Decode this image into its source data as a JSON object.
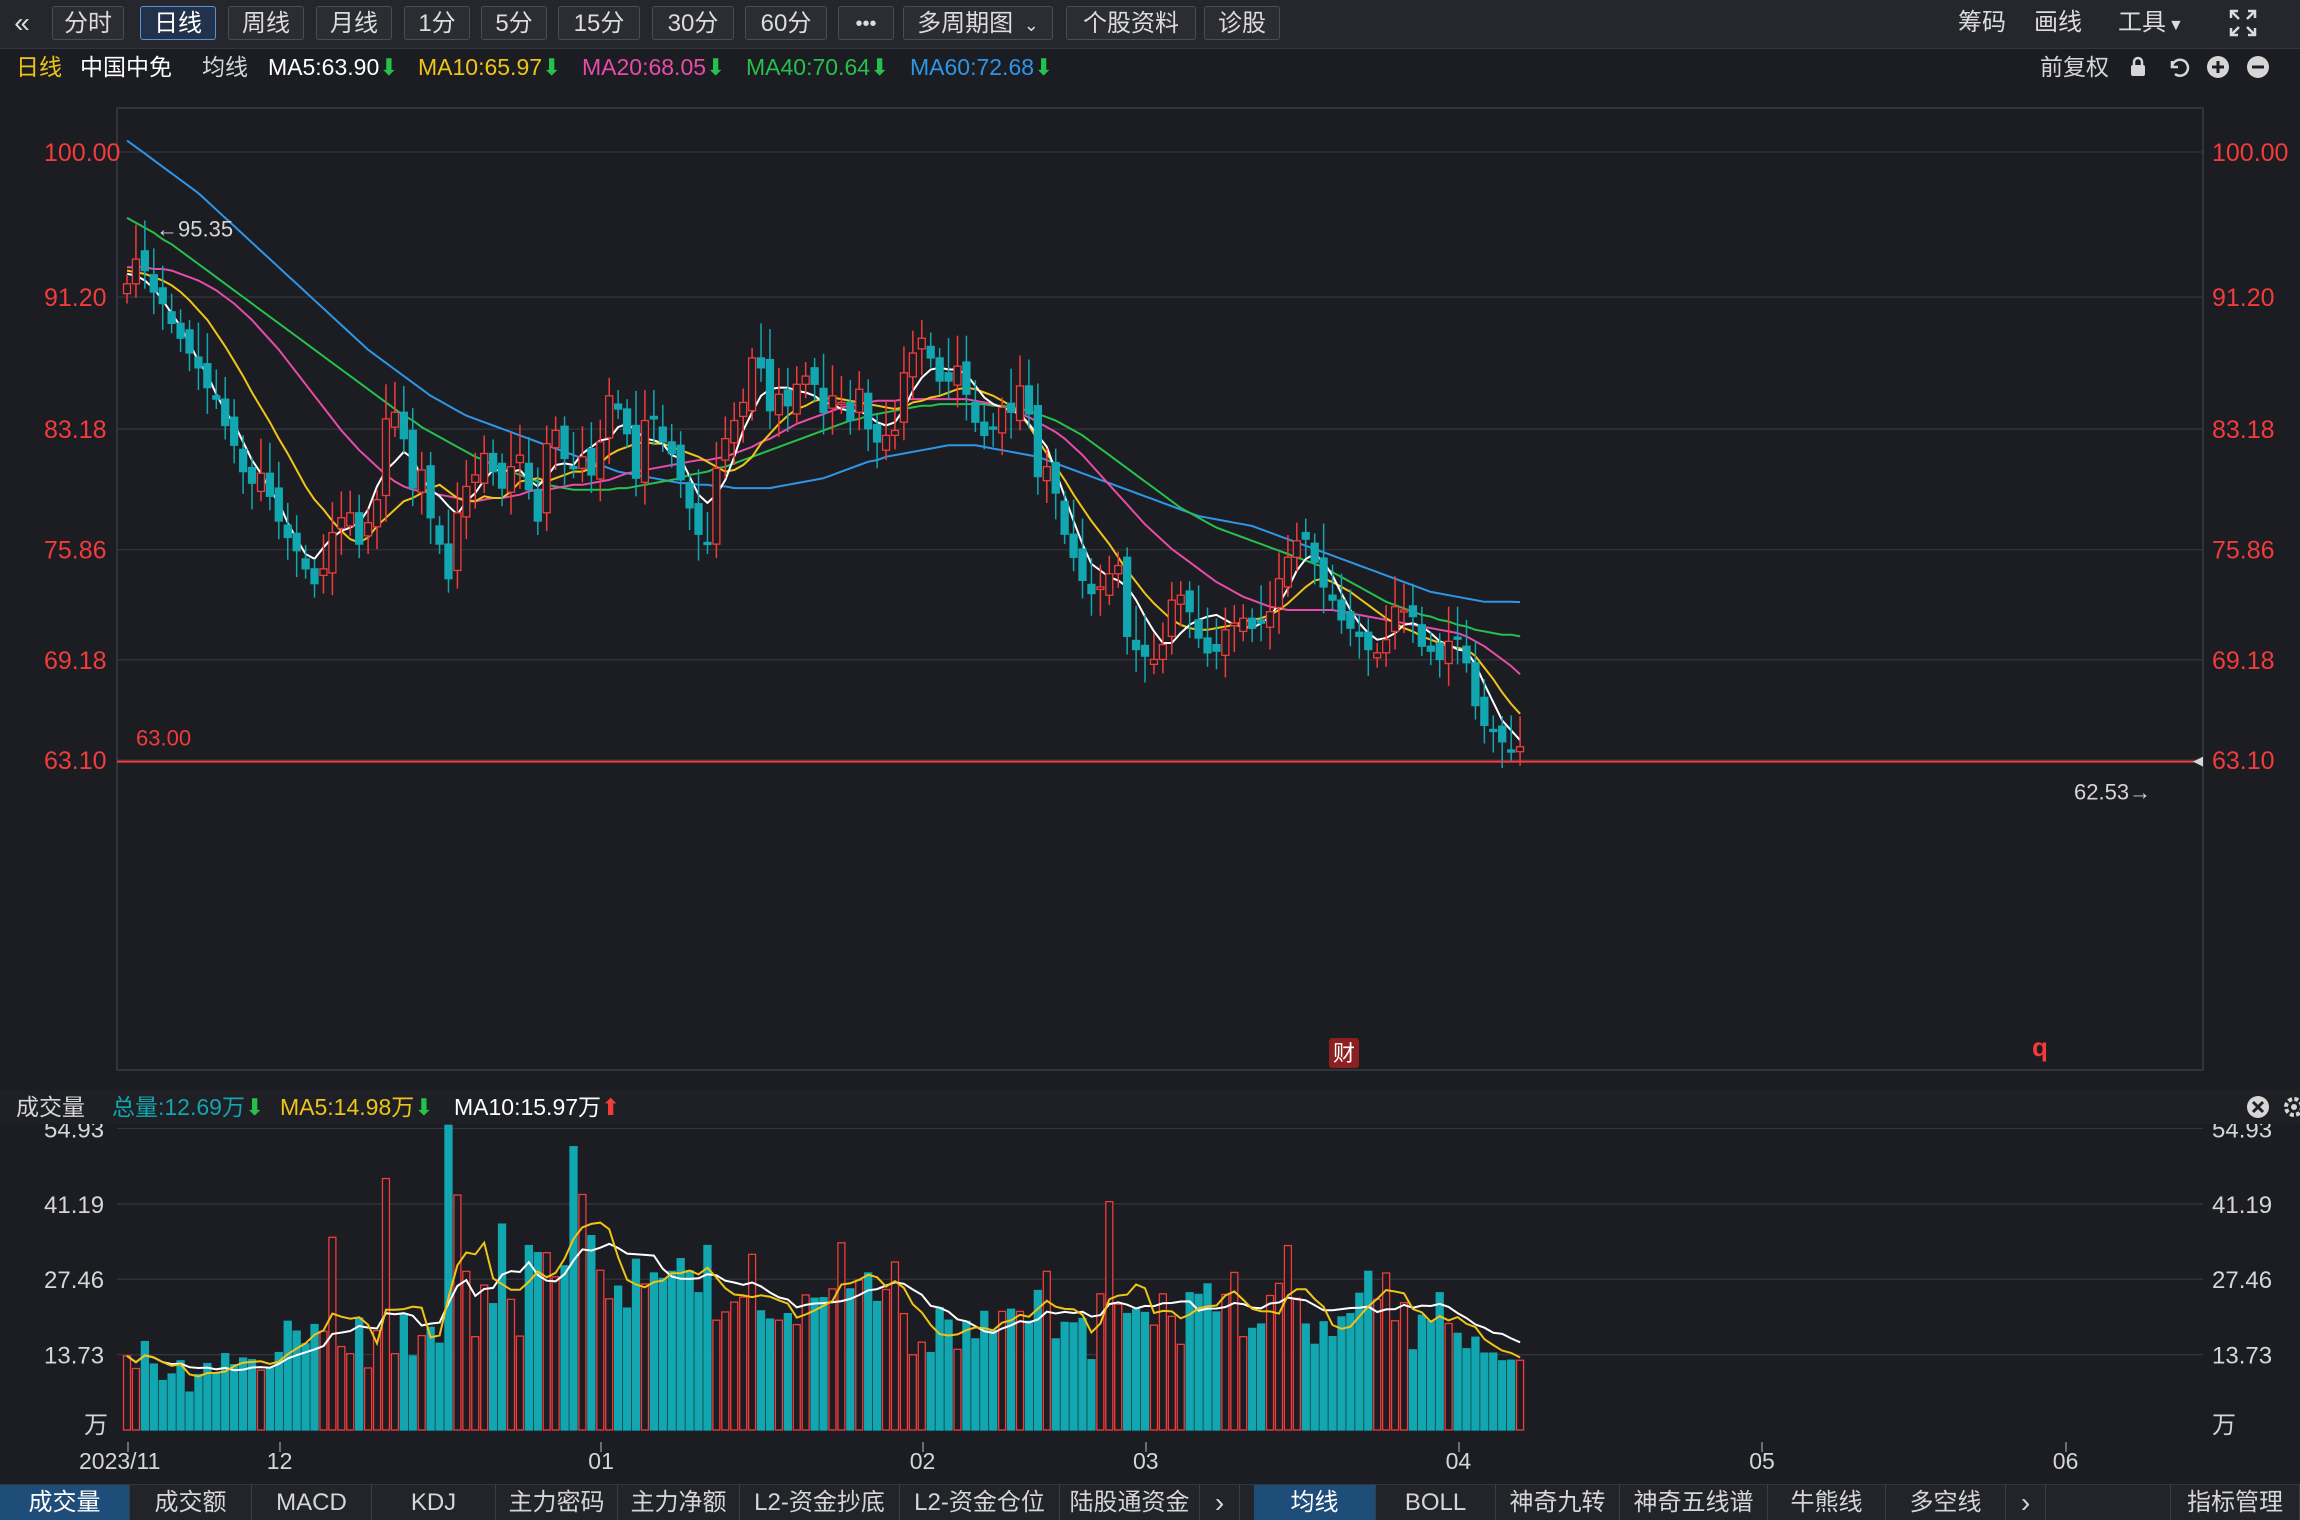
{
  "toolbar": {
    "back_icon": "double-chevron-left-icon",
    "periods": [
      "分时",
      "日线",
      "周线",
      "月线",
      "1分",
      "5分",
      "15分",
      "30分",
      "60分"
    ],
    "active_period": "日线",
    "more_label": "•••",
    "multi_period": "多周期图",
    "stock_info": "个股资料",
    "diagnose": "诊股",
    "chips": "筹码",
    "draw": "画线",
    "tools": "工具",
    "fullscreen_icon": "fullscreen-icon"
  },
  "header": {
    "period": "日线",
    "stock_name": "中国中免",
    "ma_label": "均线",
    "ma5": "MA5:63.90",
    "ma10": "MA10:65.97",
    "ma20": "MA20:68.05",
    "ma40": "MA40:70.64",
    "ma60": "MA60:72.68",
    "adjust": "前复权"
  },
  "colors": {
    "up": "#f23b3b",
    "down": "#12a6b0",
    "ma5": "#ffffff",
    "ma10": "#f0c417",
    "ma20": "#e64ca8",
    "ma40": "#26c04c",
    "ma60": "#2e96e8",
    "price_label": "#f23b3b"
  },
  "price_axis": {
    "labels": [
      "100.00",
      "91.20",
      "83.18",
      "75.86",
      "69.18",
      "63.10"
    ],
    "values": [
      100.0,
      91.2,
      83.18,
      75.86,
      69.18,
      63.1
    ]
  },
  "annotations": {
    "high": "←95.35",
    "low": "62.53→",
    "line_label": "63.00",
    "cai": "财",
    "q": "q"
  },
  "volume": {
    "title": "成交量",
    "total": "总量:12.69万",
    "ma5": "MA5:14.98万",
    "ma10": "MA10:15.97万",
    "axis_labels": [
      "54.93",
      "41.19",
      "27.46",
      "13.73",
      "万"
    ],
    "axis_values": [
      54.93,
      41.19,
      27.46,
      13.73
    ]
  },
  "x_axis": {
    "labels": [
      "2023/11",
      "12",
      "01",
      "02",
      "03",
      "04",
      "05",
      "06"
    ]
  },
  "bottom_tabs_left": [
    "成交量",
    "成交额",
    "MACD",
    "KDJ",
    "主力密码",
    "主力净额",
    "L2-资金抄底",
    "L2-资金仓位",
    "陆股通资金"
  ],
  "bottom_tabs_right": [
    "均线",
    "BOLL",
    "神奇九转",
    "神奇五线谱",
    "牛熊线",
    "多空线"
  ],
  "indicator_manage": "指标管理",
  "chart_data": {
    "type": "candlestick",
    "title": "中国中免 日线",
    "ylim": [
      60,
      102
    ],
    "months": [
      {
        "label": "2023/11",
        "start": 0
      },
      {
        "label": "12",
        "start": 17
      },
      {
        "label": "01",
        "start": 53
      },
      {
        "label": "02",
        "start": 89
      },
      {
        "label": "03",
        "start": 114
      },
      {
        "label": "04",
        "start": 149
      },
      {
        "label": "05",
        "start": 183
      },
      {
        "label": "06",
        "start": 217
      }
    ],
    "close": [
      92.0,
      93.5,
      92.8,
      91.5,
      90.8,
      89.6,
      88.7,
      87.8,
      86.9,
      85.7,
      85.0,
      83.4,
      82.2,
      80.6,
      79.9,
      80.5,
      79.1,
      77.6,
      76.6,
      75.8,
      74.7,
      73.8,
      74.7,
      76.9,
      77.8,
      78.1,
      76.2,
      77.5,
      78.9,
      83.8,
      84.2,
      82.6,
      79.6,
      80.7,
      77.8,
      76.2,
      74.1,
      78.1,
      79.7,
      80.4,
      81.7,
      80.6,
      79.6,
      80.9,
      81.6,
      79.5,
      77.6,
      82.3,
      83.1,
      81.4,
      80.8,
      81.5,
      80.4,
      82.4,
      85.2,
      84.4,
      82.9,
      80.2,
      83.7,
      83.8,
      82.4,
      81.7,
      80.1,
      78.4,
      76.8,
      76.2,
      80.8,
      82.6,
      83.7,
      84.8,
      87.5,
      86.9,
      84.3,
      85.3,
      84.6,
      85.9,
      86.4,
      85.9,
      84.2,
      85.2,
      84.8,
      83.7,
      85.6,
      83.2,
      82.4,
      82.8,
      83.1,
      86.6,
      87.8,
      88.7,
      87.5,
      86.1,
      86.1,
      87.0,
      85.3,
      83.6,
      82.8,
      83.2,
      84.5,
      84.2,
      85.8,
      84.1,
      80.3,
      80.9,
      79.3,
      76.8,
      75.4,
      74.0,
      73.2,
      73.6,
      74.4,
      74.9,
      70.6,
      69.8,
      69.4,
      69.2,
      70.1,
      72.8,
      73.1,
      72.1,
      70.5,
      69.6,
      69.7,
      71.0,
      71.4,
      71.7,
      71.1,
      71.4,
      72.1,
      74.1,
      75.4,
      76.4,
      76.5,
      75.1,
      73.6,
      72.8,
      71.6,
      71.1,
      70.6,
      69.8,
      69.6,
      70.4,
      72.4,
      72.2,
      71.8,
      70.0,
      69.7,
      69.2,
      70.3,
      70.5,
      69.0,
      66.4,
      65.2,
      64.9,
      64.2,
      63.6,
      63.9
    ],
    "ma5": [
      92.6,
      92.5,
      92.2,
      91.7,
      91.0,
      90.2,
      89.4,
      88.4,
      87.3,
      86.5,
      85.3,
      84.3,
      83.5,
      82.4,
      81.3,
      80.5,
      79.5,
      78.7,
      77.5,
      76.5,
      75.6,
      75.3,
      76.0,
      76.6,
      77.0,
      77.2,
      77.5,
      78.3,
      79.7,
      80.7,
      81.2,
      81.8,
      81.4,
      80.2,
      79.5,
      79.1,
      78.5,
      78.0,
      78.8,
      79.3,
      80.1,
      80.7,
      80.7,
      80.6,
      80.7,
      80.1,
      79.7,
      80.3,
      81.0,
      81.1,
      81.0,
      81.7,
      82.1,
      82.5,
      82.6,
      83.3,
      83.5,
      83.1,
      82.6,
      82.5,
      82.3,
      81.6,
      81.4,
      80.3,
      79.2,
      78.7,
      79.2,
      80.1,
      81.5,
      83.1,
      84.2,
      85.2,
      85.6,
      85.7,
      85.7,
      85.5,
      85.4,
      85.2,
      84.8,
      84.7,
      84.4,
      84.3,
      84.3,
      84.0,
      83.6,
      83.4,
      83.6,
      84.4,
      85.5,
      86.3,
      86.8,
      86.9,
      86.8,
      86.8,
      86.5,
      85.8,
      85.1,
      84.7,
      84.5,
      84.3,
      84.1,
      83.5,
      82.8,
      82.1,
      80.6,
      79.1,
      77.6,
      76.2,
      75.0,
      74.6,
      74.2,
      74.0,
      73.6,
      72.8,
      71.8,
      70.9,
      70.2,
      70.2,
      70.8,
      71.3,
      71.6,
      71.8,
      71.9,
      71.6,
      71.3,
      71.2,
      71.1,
      71.4,
      71.8,
      72.6,
      73.5,
      74.6,
      75.3,
      75.6,
      75.1,
      74.3,
      73.2,
      72.2,
      71.4,
      70.8,
      70.4,
      70.5,
      70.8,
      71.3,
      71.4,
      71.2,
      70.8,
      70.3,
      70.1,
      69.8,
      69.7,
      68.9,
      67.7,
      66.6,
      65.5,
      64.9,
      64.3
    ],
    "ma10": [
      92.8,
      92.7,
      92.6,
      92.4,
      92.2,
      91.9,
      91.5,
      91.0,
      90.4,
      89.8,
      89.0,
      88.2,
      87.3,
      86.4,
      85.4,
      84.5,
      83.6,
      82.6,
      81.7,
      80.7,
      79.7,
      78.9,
      78.3,
      77.6,
      77.0,
      76.5,
      76.3,
      76.6,
      77.3,
      77.8,
      78.3,
      78.8,
      79.0,
      79.3,
      79.6,
      79.8,
      79.4,
      79.0,
      78.8,
      78.8,
      79.1,
      79.0,
      79.0,
      79.4,
      80.0,
      80.1,
      80.2,
      80.0,
      80.2,
      80.4,
      80.6,
      80.6,
      80.8,
      81.1,
      81.6,
      81.9,
      82.1,
      82.3,
      82.4,
      82.3,
      82.3,
      82.1,
      81.9,
      81.7,
      81.5,
      81.2,
      80.9,
      80.6,
      80.7,
      81.0,
      81.5,
      82.3,
      82.9,
      83.5,
      84.0,
      84.4,
      84.6,
      84.9,
      85.0,
      85.1,
      85.0,
      84.9,
      84.8,
      84.7,
      84.6,
      84.5,
      84.4,
      84.5,
      84.8,
      84.9,
      85.1,
      85.2,
      85.4,
      85.6,
      85.7,
      85.6,
      85.4,
      85.2,
      84.9,
      84.6,
      84.1,
      83.4,
      82.5,
      81.7,
      80.9,
      80.1,
      79.2,
      78.4,
      77.6,
      76.9,
      76.2,
      75.4,
      74.6,
      73.9,
      73.2,
      72.6,
      72.1,
      71.6,
      71.3,
      71.1,
      71.0,
      71.0,
      71.1,
      71.2,
      71.3,
      71.5,
      71.6,
      71.7,
      71.9,
      72.2,
      72.6,
      73.1,
      73.6,
      74.0,
      74.1,
      73.9,
      73.6,
      73.3,
      72.9,
      72.5,
      72.1,
      71.7,
      71.4,
      71.1,
      70.9,
      70.6,
      70.4,
      70.2,
      70.0,
      69.9,
      69.8,
      69.4,
      68.7,
      68.0,
      67.2,
      66.5,
      65.9
    ],
    "ma20": [
      93.0,
      93.0,
      93.0,
      92.9,
      92.9,
      92.8,
      92.6,
      92.4,
      92.2,
      91.9,
      91.6,
      91.2,
      90.8,
      90.3,
      89.8,
      89.2,
      88.6,
      88.0,
      87.3,
      86.6,
      85.9,
      85.2,
      84.5,
      83.8,
      83.1,
      82.5,
      81.9,
      81.4,
      80.9,
      80.4,
      80.0,
      79.7,
      79.5,
      79.4,
      79.3,
      79.2,
      79.1,
      79.0,
      78.9,
      78.8,
      78.9,
      79.0,
      79.0,
      79.1,
      79.2,
      79.4,
      79.5,
      79.5,
      79.6,
      79.7,
      79.8,
      79.8,
      79.9,
      80.0,
      80.1,
      80.3,
      80.5,
      80.6,
      80.7,
      80.8,
      80.9,
      81.0,
      81.1,
      81.2,
      81.3,
      81.3,
      81.4,
      81.5,
      81.7,
      81.9,
      82.1,
      82.4,
      82.6,
      82.9,
      83.2,
      83.5,
      83.7,
      83.9,
      84.1,
      84.3,
      84.5,
      84.6,
      84.7,
      84.8,
      84.9,
      84.9,
      84.9,
      85.0,
      85.0,
      85.0,
      85.0,
      85.0,
      85.0,
      85.0,
      85.0,
      84.9,
      84.8,
      84.7,
      84.5,
      84.3,
      84.1,
      83.9,
      83.6,
      83.3,
      83.0,
      82.6,
      82.1,
      81.6,
      81.0,
      80.4,
      79.8,
      79.2,
      78.6,
      78.0,
      77.4,
      76.9,
      76.4,
      75.9,
      75.5,
      75.1,
      74.7,
      74.3,
      73.9,
      73.6,
      73.3,
      73.0,
      72.8,
      72.6,
      72.4,
      72.3,
      72.2,
      72.2,
      72.2,
      72.2,
      72.2,
      72.2,
      72.1,
      72.0,
      71.9,
      71.8,
      71.7,
      71.6,
      71.5,
      71.4,
      71.3,
      71.2,
      71.1,
      71.0,
      70.9,
      70.8,
      70.6,
      70.3,
      70.0,
      69.6,
      69.2,
      68.8,
      68.3
    ],
    "ma40": [
      96.0,
      95.7,
      95.4,
      95.1,
      94.7,
      94.4,
      94.0,
      93.6,
      93.2,
      92.8,
      92.4,
      92.0,
      91.6,
      91.2,
      90.8,
      90.4,
      90.0,
      89.6,
      89.2,
      88.8,
      88.4,
      88.0,
      87.6,
      87.2,
      86.8,
      86.4,
      86.0,
      85.6,
      85.2,
      84.8,
      84.4,
      84.0,
      83.7,
      83.3,
      83.0,
      82.7,
      82.4,
      82.1,
      81.8,
      81.5,
      81.3,
      81.0,
      80.8,
      80.6,
      80.4,
      80.2,
      80.0,
      79.8,
      79.7,
      79.6,
      79.5,
      79.5,
      79.5,
      79.5,
      79.5,
      79.6,
      79.6,
      79.7,
      79.8,
      79.9,
      80.0,
      80.1,
      80.2,
      80.4,
      80.5,
      80.6,
      80.8,
      80.9,
      81.1,
      81.3,
      81.5,
      81.7,
      81.9,
      82.1,
      82.3,
      82.5,
      82.7,
      82.9,
      83.1,
      83.3,
      83.5,
      83.7,
      83.8,
      84.0,
      84.1,
      84.2,
      84.3,
      84.4,
      84.5,
      84.6,
      84.6,
      84.7,
      84.7,
      84.7,
      84.7,
      84.7,
      84.7,
      84.6,
      84.6,
      84.5,
      84.4,
      84.3,
      84.1,
      83.9,
      83.7,
      83.4,
      83.1,
      82.8,
      82.4,
      82.0,
      81.6,
      81.2,
      80.8,
      80.4,
      80.0,
      79.6,
      79.2,
      78.8,
      78.4,
      78.1,
      77.8,
      77.5,
      77.2,
      77.0,
      76.8,
      76.6,
      76.4,
      76.2,
      76.0,
      75.8,
      75.6,
      75.4,
      75.2,
      75.0,
      74.8,
      74.5,
      74.2,
      73.9,
      73.6,
      73.3,
      73.0,
      72.7,
      72.5,
      72.3,
      72.1,
      71.9,
      71.8,
      71.6,
      71.5,
      71.3,
      71.2,
      71.0,
      70.9,
      70.8,
      70.7,
      70.7,
      70.6
    ],
    "ma60": [
      100.7,
      100.3,
      99.9,
      99.5,
      99.1,
      98.7,
      98.3,
      97.9,
      97.5,
      97.0,
      96.5,
      96.0,
      95.5,
      95.0,
      94.5,
      94.0,
      93.5,
      93.0,
      92.5,
      92.0,
      91.5,
      91.0,
      90.5,
      90.0,
      89.5,
      89.0,
      88.5,
      88.0,
      87.6,
      87.2,
      86.8,
      86.4,
      86.0,
      85.6,
      85.2,
      84.9,
      84.6,
      84.3,
      84.0,
      83.8,
      83.6,
      83.4,
      83.2,
      83.0,
      82.8,
      82.6,
      82.4,
      82.2,
      82.0,
      81.8,
      81.6,
      81.4,
      81.2,
      81.0,
      80.8,
      80.6,
      80.5,
      80.4,
      80.3,
      80.2,
      80.1,
      80.0,
      79.9,
      79.9,
      79.8,
      79.8,
      79.7,
      79.7,
      79.6,
      79.6,
      79.6,
      79.6,
      79.6,
      79.7,
      79.8,
      79.9,
      80.0,
      80.1,
      80.2,
      80.4,
      80.6,
      80.8,
      81.0,
      81.2,
      81.3,
      81.5,
      81.6,
      81.7,
      81.8,
      81.9,
      82.0,
      82.1,
      82.2,
      82.2,
      82.2,
      82.2,
      82.1,
      82.0,
      81.9,
      81.8,
      81.7,
      81.6,
      81.5,
      81.3,
      81.1,
      80.9,
      80.7,
      80.5,
      80.3,
      80.1,
      79.9,
      79.7,
      79.5,
      79.3,
      79.1,
      78.9,
      78.7,
      78.5,
      78.3,
      78.1,
      77.9,
      77.8,
      77.7,
      77.6,
      77.5,
      77.4,
      77.3,
      77.1,
      76.9,
      76.7,
      76.5,
      76.3,
      76.1,
      75.9,
      75.7,
      75.5,
      75.3,
      75.1,
      74.9,
      74.7,
      74.5,
      74.3,
      74.1,
      73.9,
      73.7,
      73.5,
      73.3,
      73.2,
      73.1,
      73.0,
      72.9,
      72.8,
      72.7,
      72.7,
      72.7,
      72.7,
      72.68
    ],
    "volume_wan": [
      13.5,
      11.2,
      16.1,
      12.0,
      9.0,
      10.2,
      12.6,
      6.9,
      10.1,
      12.1,
      10.3,
      13.9,
      11.9,
      13.1,
      12.8,
      10.9,
      11.4,
      14.1,
      19.8,
      18.0,
      15.7,
      19.2,
      18.0,
      35.1,
      15.2,
      13.9,
      20.4,
      11.3,
      18.1,
      45.8,
      13.9,
      21.0,
      13.5,
      17.2,
      18.7,
      15.8,
      55.5,
      42.8,
      28.9,
      17.0,
      26.4,
      23.0,
      37.5,
      23.8,
      17.1,
      33.6,
      32.3,
      32.3,
      27.9,
      29.9,
      51.6,
      42.9,
      35.4,
      29.1,
      23.9,
      26.2,
      22.2,
      31.1,
      26.6,
      28.6,
      27.6,
      28.9,
      31.2,
      29.0,
      25.0,
      33.6,
      20.0,
      21.5,
      23.3,
      24.2,
      32.0,
      21.7,
      20.2,
      20.0,
      21.2,
      19.2,
      24.6,
      24.0,
      24.1,
      25.7,
      34.1,
      25.7,
      27.3,
      28.6,
      23.4,
      25.6,
      30.6,
      21.2,
      13.7,
      16.0,
      14.1,
      22.3,
      20.0,
      14.7,
      19.8,
      16.6,
      21.6,
      18.1,
      21.6,
      22.0,
      21.6,
      19.8,
      25.4,
      28.9,
      16.6,
      19.6,
      19.5,
      20.3,
      12.8,
      24.8,
      41.6,
      22.9,
      21.2,
      22.0,
      21.4,
      19.1,
      24.8,
      20.7,
      15.6,
      25.0,
      24.7,
      26.6,
      21.5,
      24.7,
      28.7,
      17.0,
      18.5,
      19.3,
      24.5,
      26.7,
      33.6,
      24.0,
      19.3,
      15.6,
      19.7,
      17.0,
      20.6,
      21.2,
      24.9,
      28.9,
      23.8,
      28.6,
      19.9,
      23.2,
      14.6,
      20.9,
      19.9,
      25.0,
      19.4,
      17.6,
      14.8,
      16.9,
      14.0,
      14.0,
      12.6,
      12.7,
      12.7
    ],
    "price_line": 63.0,
    "high_marker": 95.35,
    "low_marker": 62.53
  }
}
